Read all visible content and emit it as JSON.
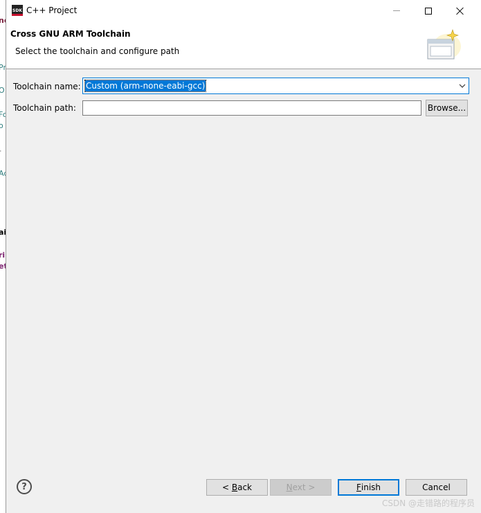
{
  "background": {
    "fragments": [
      "nc",
      "Pr",
      "O",
      "Fo",
      "o",
      "-",
      "Ac",
      "ai",
      "ri",
      "et"
    ]
  },
  "window": {
    "title": "C++ Project",
    "icon_text": "SDK",
    "icon": "sdk-icon",
    "controls": [
      "minimize-icon",
      "maximize-icon",
      "close-icon"
    ]
  },
  "banner": {
    "title": "Cross GNU ARM Toolchain",
    "description": "Select the toolchain and configure path",
    "icon": "wizard-icon"
  },
  "form": {
    "toolchain_name_label": "Toolchain name:",
    "toolchain_name_value": "Custom (arm-none-eabi-gcc)",
    "toolchain_path_label": "Toolchain path:",
    "toolchain_path_value": "",
    "browse_label": "Browse..."
  },
  "footer": {
    "help_icon": "help-icon",
    "back": {
      "prefix": "< ",
      "mnemonic": "B",
      "rest": "ack"
    },
    "next": {
      "mnemonic": "N",
      "rest": "ext >"
    },
    "finish": {
      "mnemonic": "F",
      "rest": "inish"
    },
    "cancel_label": "Cancel"
  },
  "watermark": "CSDN @走错路的程序员",
  "colors": {
    "accent": "#0078d7",
    "dialog_bg": "#f0f0f0",
    "banner_bg": "#ffffff"
  }
}
